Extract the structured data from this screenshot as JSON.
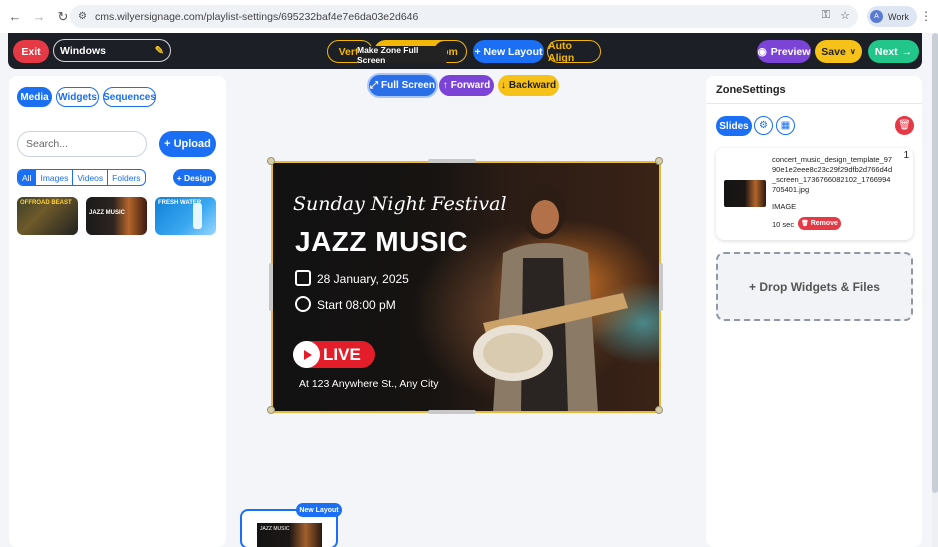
{
  "browser": {
    "url": "cms.wilyersignage.com/playlist-settings/695232baf4e7e6da03e2d646",
    "profile_label": "Work",
    "profile_initial": "A"
  },
  "toolbar": {
    "exit_label": "Exit",
    "playlist_name": "Windows",
    "vertical_label": "Verti",
    "zoom_label": "om",
    "tooltip": "Make Zone Full Screen",
    "new_layout_label": "+ New Layout",
    "auto_align_label": "Auto Align",
    "preview_label": "Preview",
    "save_label": "Save",
    "next_label": "Next"
  },
  "zone_toolbar": {
    "full_screen_label": "Full Screen",
    "forward_label": "Forward",
    "backward_label": "Backward"
  },
  "left_panel": {
    "tabs": [
      {
        "label": "Media",
        "active": true
      },
      {
        "label": "Widgets",
        "active": false
      },
      {
        "label": "Sequences",
        "active": false
      }
    ],
    "search_placeholder": "Search...",
    "upload_label": "+ Upload",
    "filters": [
      {
        "label": "All",
        "active": true
      },
      {
        "label": "Images",
        "active": false
      },
      {
        "label": "Videos",
        "active": false
      },
      {
        "label": "Folders",
        "active": false
      }
    ],
    "design_label": "+ Design",
    "thumbnails": [
      {
        "text": "OFFROAD BEAST"
      },
      {
        "text": "JAZZ MUSIC"
      },
      {
        "text": "FRESH WATER"
      }
    ]
  },
  "canvas": {
    "poster": {
      "title_script": "Sunday Night Festival",
      "title_main": "JAZZ MUSIC",
      "date": "28 January, 2025",
      "time": "Start 08:00 pM",
      "live": "LIVE",
      "address": "At 123 Anywhere St., Any City"
    }
  },
  "layout_thumb": {
    "badge": "New Layout",
    "mini_text": "JAZZ MUSIC"
  },
  "right_panel": {
    "title": "ZoneSettings",
    "slides_label": "Slides",
    "slide": {
      "number": "1",
      "filename": "concert_music_design_template_9790e1e2eee8c23c29f29dfb2d766d4d_screen_1736766082102_1766994705401.jpg",
      "type": "IMAGE",
      "duration": "10 sec",
      "remove_label": "Remove"
    },
    "drop_label": "+ Drop Widgets & Files"
  },
  "colors": {
    "primary": "#1a6ff4",
    "danger": "#e53945",
    "purple": "#7b44d6",
    "yellow": "#f6c21a",
    "green": "#22c58a",
    "toolbar_bg": "#1c1f26"
  }
}
